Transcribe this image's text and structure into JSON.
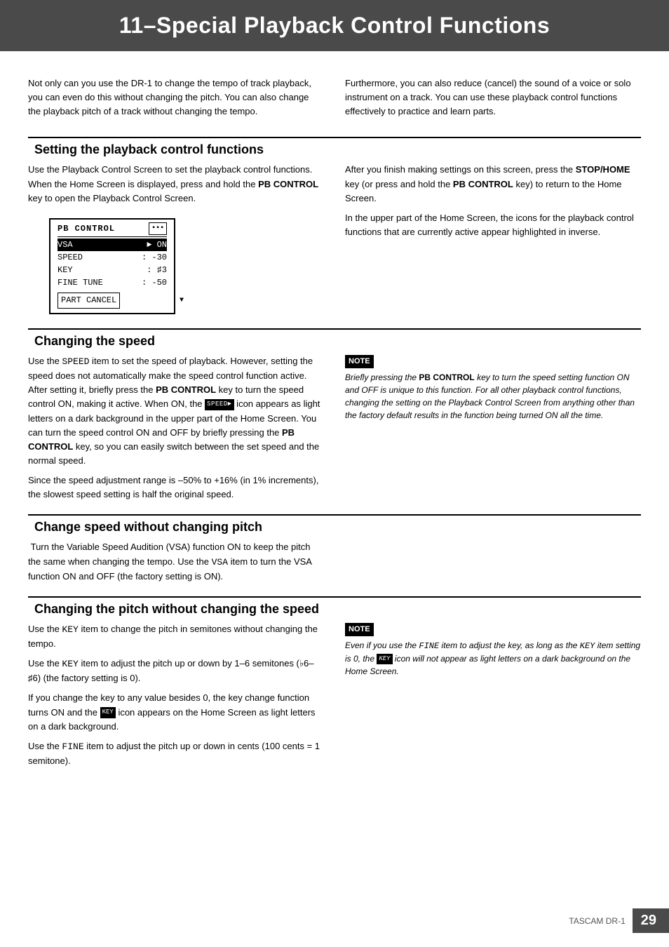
{
  "header": {
    "title": "11–Special Playback Control Functions"
  },
  "intro": {
    "left": "Not only can you use the DR-1 to change the tempo of track playback, you can even do this without changing the pitch. You can also change the playback pitch of a track without changing the tempo.",
    "right": "Furthermore, you can also reduce (cancel) the sound of a voice or solo instrument on a track. You can use these playback control functions effectively to practice and learn parts."
  },
  "sections": [
    {
      "id": "setting",
      "title": "Setting the playback control functions",
      "left": "Use the Playback Control Screen to set the playback control functions. When the Home Screen is displayed, press and hold the PB CONTROL key to open the Playback Control Screen.",
      "left_bold_words": [
        "PB CONTROL"
      ],
      "screen": {
        "title": "PB CONTROL",
        "rows": [
          {
            "key": "VSA",
            "val": "► ON",
            "highlighted": true
          },
          {
            "key": "SPEED",
            "val": ": -30"
          },
          {
            "key": "KEY",
            "val": ": ♯3"
          },
          {
            "key": "FINE TUNE",
            "val": ": -50"
          }
        ],
        "part_cancel": "PART CANCEL"
      },
      "right_p1": "After you finish making settings on this screen, press the STOP/HOME key (or press and hold the PB CONTROL key) to return to the Home Screen.",
      "right_p1_bold": [
        "STOP/HOME",
        "PB CONTROL"
      ],
      "right_p2": "In the upper part of the Home Screen, the icons for the playback control functions that are currently active appear highlighted in inverse."
    },
    {
      "id": "speed",
      "title": "Changing the speed",
      "left_paragraphs": [
        "Use the SPEED item to set the speed of playback. However, setting the speed does not automatically make the speed control function active. After setting it, briefly press the PB CONTROL key to turn the speed control ON, making it active. When ON, the [SPEED] icon appears as light letters on a dark background in the upper part of the Home Screen. You can turn the speed control ON and OFF by briefly pressing the PB CONTROL key, so you can easily switch between the set speed and the normal speed.",
        "Since the speed adjustment range is –50% to +16% (in 1% increments), the slowest speed setting is half the original speed."
      ],
      "note": {
        "label": "NOTE",
        "text": "Briefly pressing the PB CONTROL key to turn the speed setting function ON and OFF is unique to this function. For all other playback control functions, changing the setting on the Playback Control Screen from anything other than the factory default results in the function being turned ON all the time."
      }
    },
    {
      "id": "change-speed",
      "title": "Change speed without changing pitch",
      "left_paragraphs": [
        "Turn the Variable Speed Audition (VSA) function ON to keep the pitch the same when changing the tempo. Use the VSA item to turn the VSA function ON and OFF (the factory setting is ON)."
      ]
    },
    {
      "id": "pitch",
      "title": "Changing the pitch without changing the speed",
      "left_paragraphs": [
        "Use the KEY item to change the pitch in semitones without changing the tempo.",
        "Use the KEY item to adjust the pitch up or down by 1–6 semitones (♭6–♯6) (the factory setting is 0).",
        "If you change the key to any value besides 0, the key change function turns ON and the [KEY] icon appears on the Home Screen as light letters on a dark background.",
        "Use the FINE item to adjust the pitch up or down in cents (100 cents = 1 semitone)."
      ],
      "note": {
        "label": "NOTE",
        "text": "Even if you use the FINE item to adjust the key, as long as the KEY item setting is 0, the [KEY] icon will not appear as light letters on a dark background on the Home Screen."
      }
    }
  ],
  "footer": {
    "brand": "TASCAM DR-1",
    "page": "29"
  }
}
